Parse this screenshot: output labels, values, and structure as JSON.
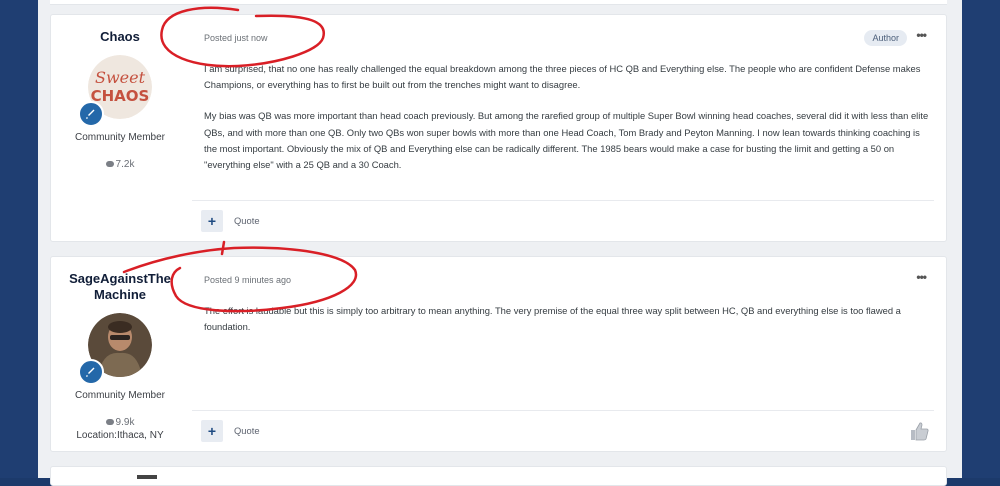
{
  "posts": [
    {
      "author": "Chaos",
      "avatar_lines": [
        "Sweet",
        "CHAOS"
      ],
      "member_title": "Community Member",
      "post_count": "7.2k",
      "posted": "Posted just now",
      "author_badge": "Author",
      "paragraphs": [
        "I am surprised, that no one has really challenged the equal breakdown among the three pieces of HC QB and Everything else.  The people who are confident Defense makes Champions, or everything has to first be built out from the trenches might want to disagree.",
        "My bias was QB was more important than head coach previously.   But among the rarefied group of multiple Super Bowl winning head coaches, several did it with less than elite QBs, and with more than one QB.  Only two QBs won super bowls with more than one Head Coach,  Tom Brady and Peyton Manning. I now lean towards thinking coaching is the most important.   Obviously the mix of QB and Everything else can be radically different.  The 1985 bears would make a case for busting the limit and getting a 50 on \"everything else\" with a 25 QB and a 30 Coach."
      ],
      "quote_label": "Quote",
      "plus_label": "+"
    },
    {
      "author_line1": "SageAgainstThe",
      "author_line2": "Machine",
      "member_title": "Community Member",
      "post_count": "9.9k",
      "location": "Location:Ithaca, NY",
      "posted": "Posted 9 minutes ago",
      "paragraphs": [
        "The effort is laudable but this is simply too arbitrary to mean anything.  The very premise of the equal three way split between HC, QB and everything else is too flawed a foundation."
      ],
      "quote_label": "Quote",
      "plus_label": "+"
    }
  ],
  "icons": {
    "more": "more-options-icon",
    "badge": "rocket-badge-icon",
    "comment": "comment-icon",
    "like": "thumbs-up-icon"
  },
  "colors": {
    "background": "#1c3a6b",
    "accent": "#2468a9",
    "annotation": "#d91f26"
  },
  "more_glyph": "•••"
}
